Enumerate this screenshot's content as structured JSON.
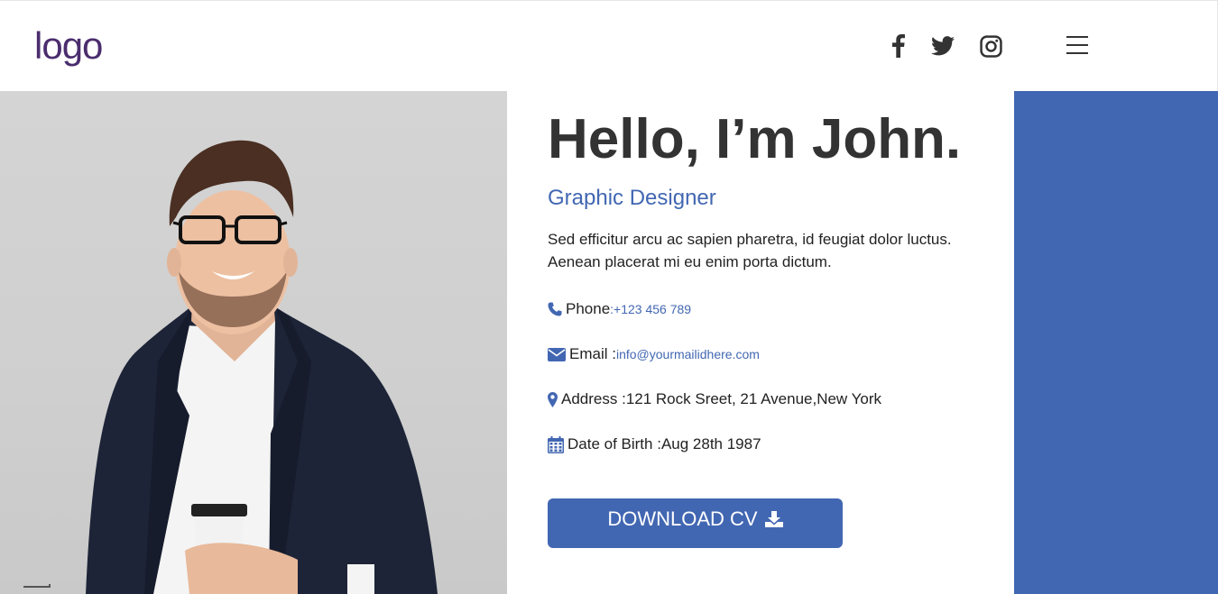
{
  "colors": {
    "accent": "#4267b2",
    "logo": "#4b2d6e",
    "heading": "#333333"
  },
  "header": {
    "logo": "logo",
    "social_icons": [
      "facebook-icon",
      "twitter-icon",
      "instagram-icon"
    ],
    "menu_icon": "hamburger-menu-icon"
  },
  "profile": {
    "heading": "Hello, I’m John.",
    "role": "Graphic Designer",
    "bio": "Sed efficitur arcu ac sapien pharetra, id feugiat dolor luctus. Aenean placerat mi eu enim porta dictum."
  },
  "contact": {
    "phone_label": "Phone",
    "phone_value": ":+123 456 789",
    "email_label": "Email :",
    "email_value": "info@yourmailidhere.com",
    "address_label": "Address :",
    "address_value": "121 Rock Sreet, 21 Avenue,New York",
    "dob_label": "Date of Birth :",
    "dob_value": "Aug 28th 1987"
  },
  "cta": {
    "download_label": "DOWNLOAD CV"
  }
}
